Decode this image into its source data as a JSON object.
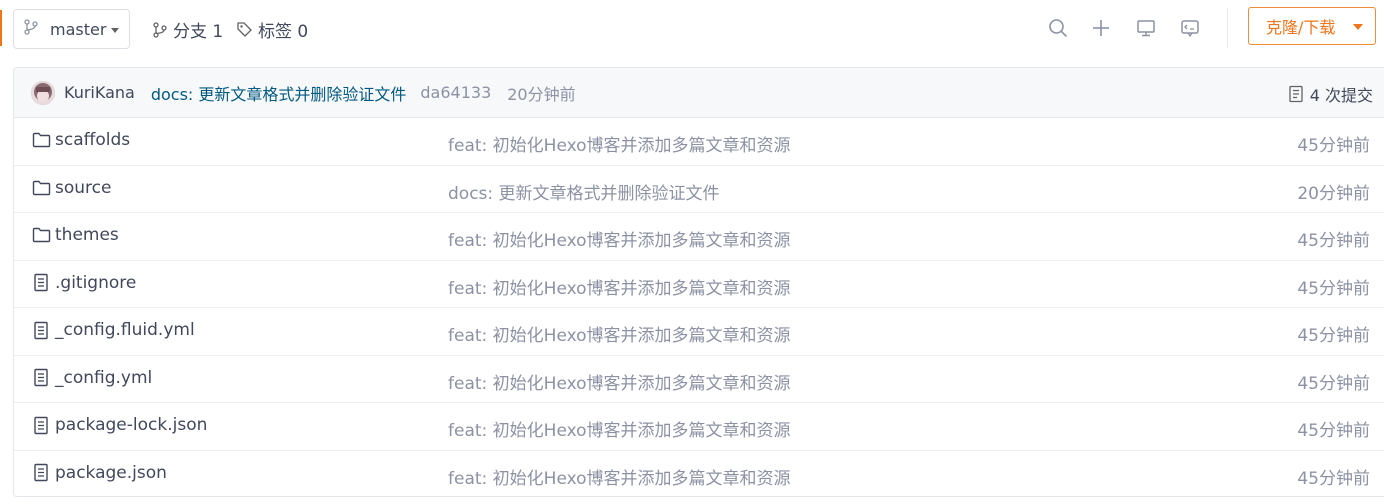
{
  "toolbar": {
    "branch": "master",
    "branches_label": "分支 1",
    "tags_label": "标签 0",
    "clone_label": "克隆/下载",
    "icons": [
      "search-icon",
      "plus-icon",
      "monitor-icon",
      "web-ide-icon"
    ]
  },
  "latest_commit": {
    "author": "KuriKana",
    "message": "docs: 更新文章格式并删除验证文件",
    "sha": "da64133",
    "time": "20分钟前",
    "commit_count": "4 次提交"
  },
  "files": [
    {
      "type": "folder",
      "name": "scaffolds",
      "commit": "feat: 初始化Hexo博客并添加多篇文章和资源",
      "time": "45分钟前"
    },
    {
      "type": "folder",
      "name": "source",
      "commit": "docs: 更新文章格式并删除验证文件",
      "time": "20分钟前"
    },
    {
      "type": "folder",
      "name": "themes",
      "commit": "feat: 初始化Hexo博客并添加多篇文章和资源",
      "time": "45分钟前"
    },
    {
      "type": "file",
      "name": ".gitignore",
      "commit": "feat: 初始化Hexo博客并添加多篇文章和资源",
      "time": "45分钟前"
    },
    {
      "type": "file",
      "name": "_config.fluid.yml",
      "commit": "feat: 初始化Hexo博客并添加多篇文章和资源",
      "time": "45分钟前"
    },
    {
      "type": "file",
      "name": "_config.yml",
      "commit": "feat: 初始化Hexo博客并添加多篇文章和资源",
      "time": "45分钟前"
    },
    {
      "type": "file",
      "name": "package-lock.json",
      "commit": "feat: 初始化Hexo博客并添加多篇文章和资源",
      "time": "45分钟前"
    },
    {
      "type": "file",
      "name": "package.json",
      "commit": "feat: 初始化Hexo博客并添加多篇文章和资源",
      "time": "45分钟前"
    }
  ],
  "colors": {
    "accent": "#f0741a",
    "commit_link": "#005980",
    "muted_text": "#8c92a4",
    "text": "#40485b"
  }
}
